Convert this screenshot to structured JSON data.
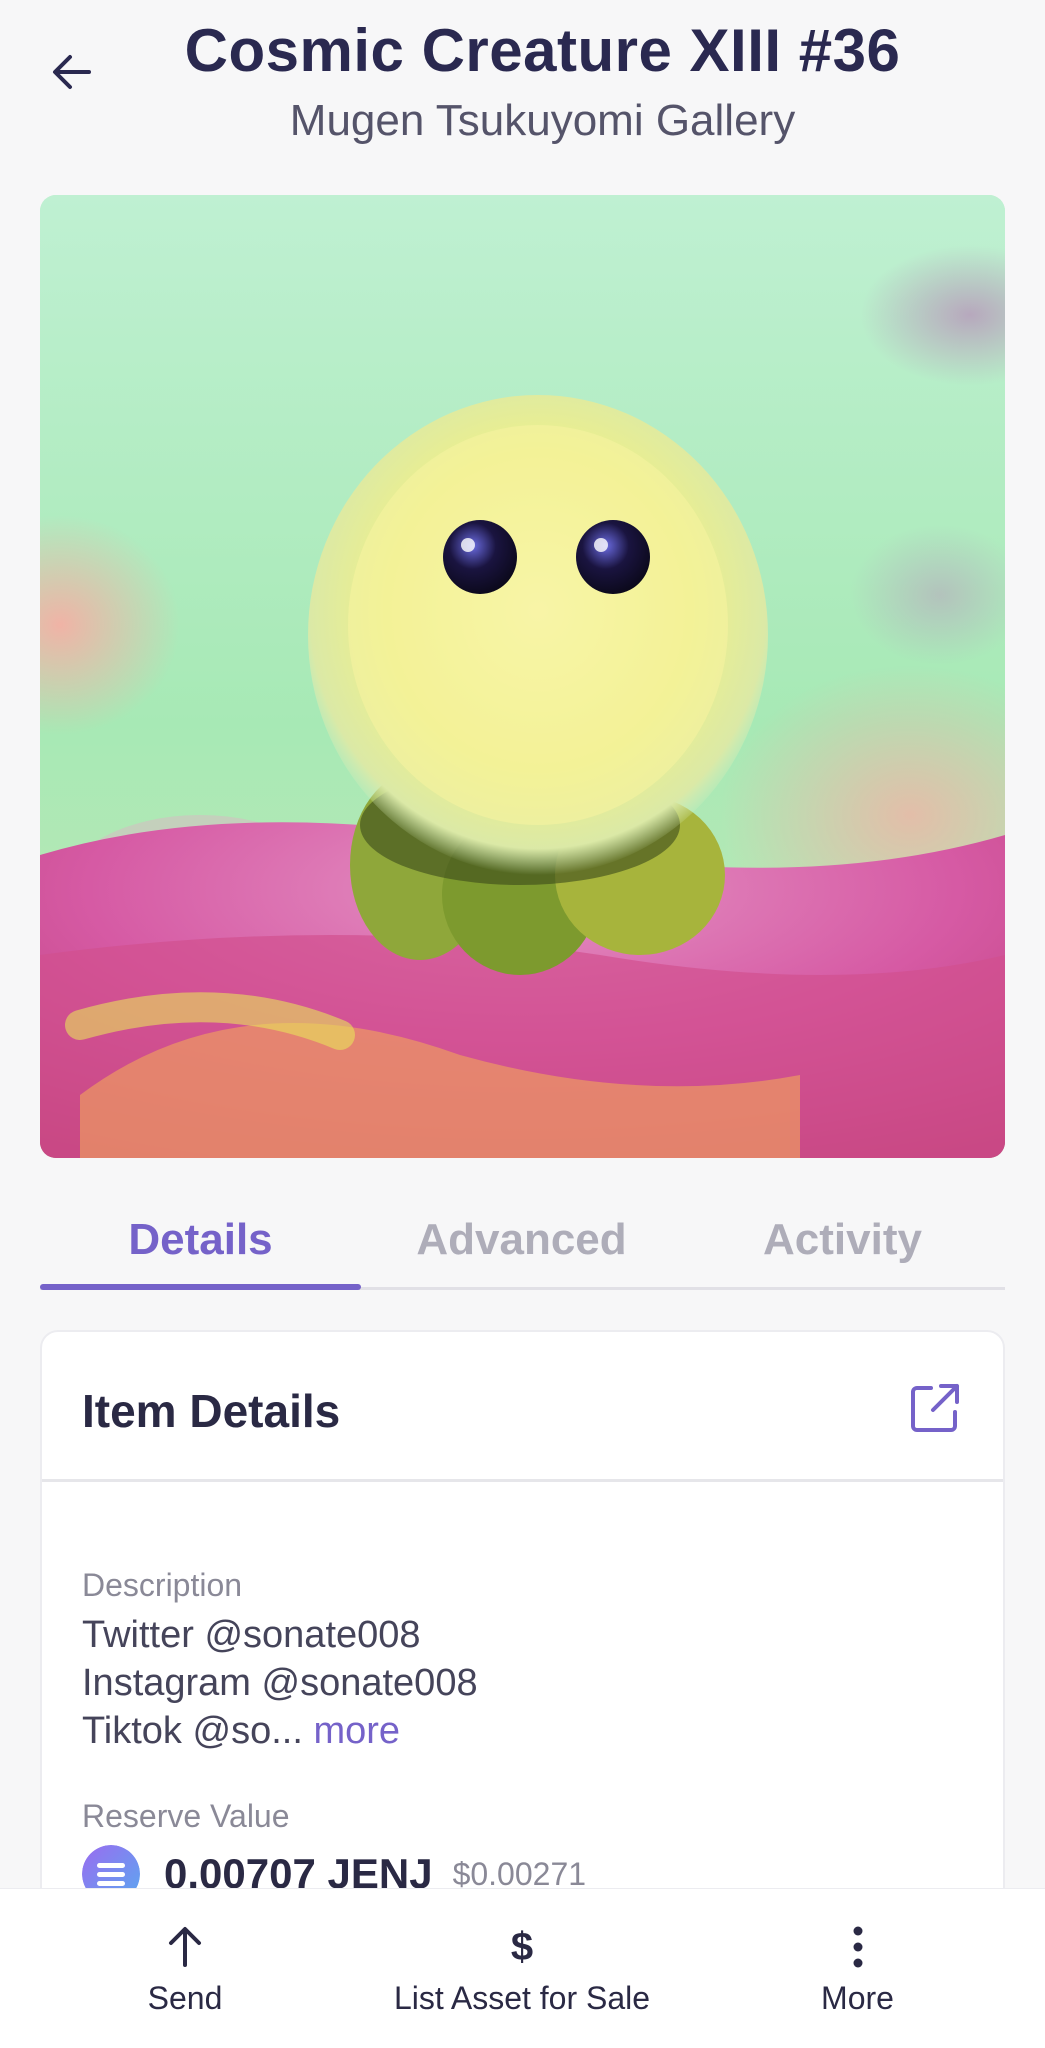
{
  "header": {
    "title": "Cosmic Creature XIII #36",
    "subtitle": "Mugen Tsukuyomi Gallery",
    "back_icon": "arrow-left-icon"
  },
  "artwork": {
    "alt": "Fluffy yellow creature with big dark eyes sitting on pink fur"
  },
  "tabs": [
    {
      "label": "Details",
      "active": true
    },
    {
      "label": "Advanced",
      "active": false
    },
    {
      "label": "Activity",
      "active": false
    }
  ],
  "item_details": {
    "title": "Item Details",
    "external_icon": "external-link-icon",
    "description_label": "Description",
    "description_lines": [
      "Twitter @sonate008",
      "Instagram @sonate008",
      "Tiktok @so..."
    ],
    "more_label": "more",
    "reserve_label": "Reserve Value",
    "reserve_amount": "0.00707 JENJ",
    "reserve_usd": "$0.00271"
  },
  "bottom_bar": {
    "send_label": "Send",
    "list_label": "List Asset for Sale",
    "list_icon": "$",
    "more_label": "More"
  },
  "colors": {
    "accent": "#7562c9",
    "title": "#2a2950",
    "background": "#f7f7f8"
  }
}
